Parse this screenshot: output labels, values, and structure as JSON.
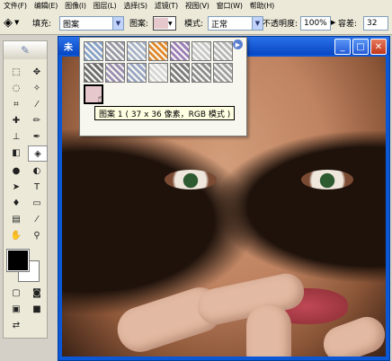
{
  "menubar": {
    "items": [
      "文件(F)",
      "编辑(E)",
      "图像(I)",
      "图层(L)",
      "选择(S)",
      "滤镜(T)",
      "视图(V)",
      "窗口(W)",
      "帮助(H)"
    ]
  },
  "options": {
    "tool_icon": "paint-bucket-icon",
    "fill_label": "填充:",
    "fill_value": "图案",
    "pattern_label": "图案:",
    "mode_label": "模式:",
    "mode_value": "正常",
    "opacity_label": "不透明度:",
    "opacity_value": "100%",
    "tolerance_label": "容差:",
    "tolerance_value": "32"
  },
  "document": {
    "title": "未"
  },
  "pattern_picker": {
    "selected_index": 14,
    "tooltip": "图案 1 ( 37 x 36 像素，RGB 模式 )",
    "swatch_colors": [
      "#8aa3c8",
      "#9a9aa8",
      "#a9b4c9",
      "#e08a2e",
      "#9c7fb8",
      "#c9c9c9",
      "#b7b7b7",
      "#6f6f6f",
      "#9b8fb0",
      "#9aa7c3",
      "#d7d7d7",
      "#7d7d7d",
      "#8e8e8e",
      "#a1a1a1",
      "#e6c8cc"
    ]
  },
  "colors": {
    "foreground": "#000000",
    "background": "#ffffff",
    "pattern_swatch": "#e6c8cc"
  }
}
